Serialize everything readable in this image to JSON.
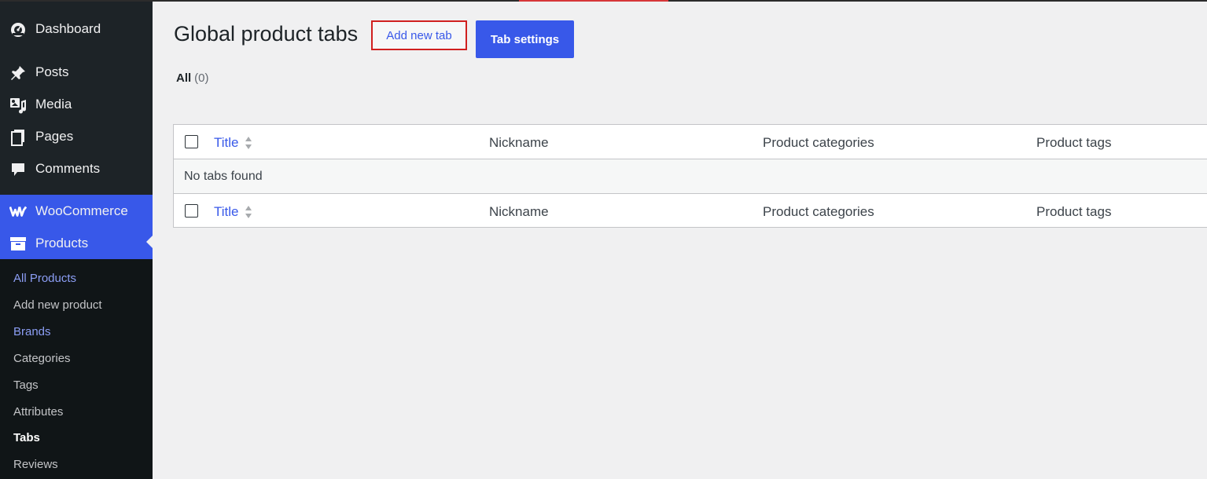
{
  "sidebar": {
    "items": [
      {
        "label": "Dashboard",
        "icon": "dashboard-icon"
      },
      {
        "label": "Posts",
        "icon": "pin-icon"
      },
      {
        "label": "Media",
        "icon": "media-icon"
      },
      {
        "label": "Pages",
        "icon": "pages-icon"
      },
      {
        "label": "Comments",
        "icon": "comment-icon"
      },
      {
        "label": "WooCommerce",
        "icon": "woocommerce-icon"
      },
      {
        "label": "Products",
        "icon": "archive-box-icon"
      }
    ],
    "submenu": [
      {
        "label": "All Products"
      },
      {
        "label": "Add new product"
      },
      {
        "label": "Brands"
      },
      {
        "label": "Categories"
      },
      {
        "label": "Tags"
      },
      {
        "label": "Attributes"
      },
      {
        "label": "Tabs"
      },
      {
        "label": "Reviews"
      }
    ]
  },
  "header": {
    "title": "Global product tabs",
    "add_new_label": "Add new tab",
    "settings_label": "Tab settings"
  },
  "filter": {
    "all_label": "All",
    "all_count": "(0)"
  },
  "table": {
    "columns": [
      "Title",
      "Nickname",
      "Product categories",
      "Product tags"
    ],
    "empty_message": "No tabs found"
  },
  "colors": {
    "accent": "#3858e9",
    "highlight_border": "#d0201f",
    "sidebar_bg": "#1d2327"
  }
}
